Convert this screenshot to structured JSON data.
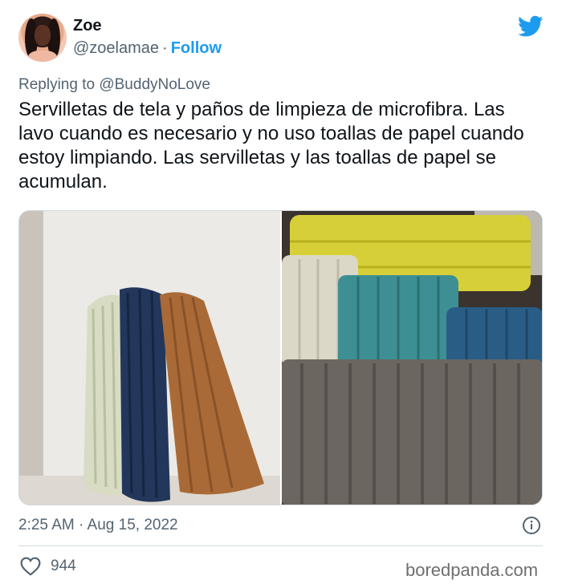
{
  "user": {
    "display_name": "Zoe",
    "handle": "@zoelamae",
    "separator": "·",
    "follow_label": "Follow"
  },
  "reply": {
    "prefix": "Replying to",
    "mention": "@BuddyNoLove"
  },
  "tweet": {
    "text": "Servilletas de tela y paños de limpieza de microfibra. Las lavo cuando es necesario y no uso toallas de papel cuando estoy limpiando. Las servilletas y las toallas de papel se acumulan."
  },
  "footer": {
    "timestamp": "2:25 AM · Aug 15, 2022",
    "like_count": "944"
  },
  "watermark": "boredpanda.com",
  "icons": {
    "bird": "twitter-bird-icon",
    "info": "info-icon",
    "heart": "heart-icon"
  },
  "colors": {
    "brand_blue": "#1d9bf0",
    "secondary_text": "#536471",
    "border": "#cfd9de"
  }
}
